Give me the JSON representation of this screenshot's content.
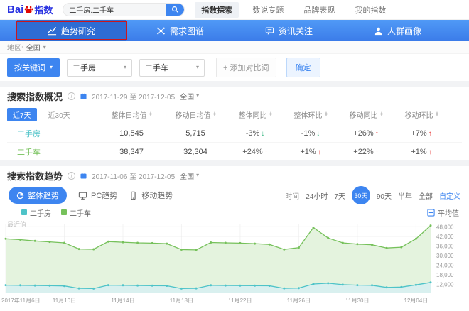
{
  "brand": {
    "text": "Bai",
    "suffix": "指数"
  },
  "header": {
    "search_value": "二手房,二手车",
    "nav": [
      {
        "label": "指数探索",
        "active": true
      },
      {
        "label": "数说专题",
        "active": false
      },
      {
        "label": "品牌表现",
        "active": false
      },
      {
        "label": "我的指数",
        "active": false
      }
    ]
  },
  "subnav": [
    {
      "label": "趋势研究",
      "icon": "trend",
      "active": true,
      "annotated": true
    },
    {
      "label": "需求图谱",
      "icon": "network",
      "active": false,
      "annotated": false
    },
    {
      "label": "资讯关注",
      "icon": "news",
      "active": false,
      "annotated": false
    },
    {
      "label": "人群画像",
      "icon": "people",
      "active": false,
      "annotated": false
    }
  ],
  "region_bar": {
    "label": "地区:",
    "value": "全国"
  },
  "keyword_bar": {
    "mode_button": "按关键词",
    "keywords": [
      "二手房",
      "二手车"
    ],
    "add_compare": "+ 添加对比词",
    "confirm": "确定"
  },
  "overview": {
    "title": "搜索指数概况",
    "date_range": "2017-11-29 至 2017-12-05",
    "region": "全国",
    "range_tabs": [
      {
        "label": "近7天",
        "active": true
      },
      {
        "label": "近30天",
        "active": false
      }
    ],
    "columns": [
      "整体日均值",
      "移动日均值",
      "整体同比",
      "整体环比",
      "移动同比",
      "移动环比"
    ],
    "rows": [
      {
        "keyword": "二手房",
        "color": "#4ec3c8",
        "values": [
          "10,545",
          "5,715"
        ],
        "changes": [
          {
            "text": "-3%",
            "dir": "down"
          },
          {
            "text": "-1%",
            "dir": "down"
          },
          {
            "text": "+26%",
            "dir": "up"
          },
          {
            "text": "+7%",
            "dir": "up"
          }
        ]
      },
      {
        "keyword": "二手车",
        "color": "#76c15b",
        "values": [
          "38,347",
          "32,304"
        ],
        "changes": [
          {
            "text": "+24%",
            "dir": "up"
          },
          {
            "text": "+1%",
            "dir": "up"
          },
          {
            "text": "+22%",
            "dir": "up"
          },
          {
            "text": "+1%",
            "dir": "up"
          }
        ]
      }
    ]
  },
  "trend": {
    "title": "搜索指数趋势",
    "date_range": "2017-11-06 至 2017-12-05",
    "region": "全国",
    "view_tabs": [
      {
        "label": "整体趋势",
        "icon": "overall",
        "active": true
      },
      {
        "label": "PC趋势",
        "icon": "pc",
        "active": false
      },
      {
        "label": "移动趋势",
        "icon": "mobile",
        "active": false
      }
    ],
    "time_label": "时间",
    "time_ranges": [
      {
        "label": "24小时",
        "active": false,
        "link": false
      },
      {
        "label": "7天",
        "active": false,
        "link": false
      },
      {
        "label": "30天",
        "active": true,
        "link": false
      },
      {
        "label": "90天",
        "active": false,
        "link": false
      },
      {
        "label": "半年",
        "active": false,
        "link": false
      },
      {
        "label": "全部",
        "active": false,
        "link": false
      },
      {
        "label": "自定义",
        "active": false,
        "link": true
      }
    ],
    "average_toggle": "平均值",
    "chart_hint": "最近值"
  },
  "chart_data": {
    "type": "line",
    "title": "搜索指数趋势",
    "x": [
      "2017-11-06",
      "2017-11-07",
      "2017-11-08",
      "2017-11-09",
      "2017-11-10",
      "2017-11-11",
      "2017-11-12",
      "2017-11-13",
      "2017-11-14",
      "2017-11-15",
      "2017-11-16",
      "2017-11-17",
      "2017-11-18",
      "2017-11-19",
      "2017-11-20",
      "2017-11-21",
      "2017-11-22",
      "2017-11-23",
      "2017-11-24",
      "2017-11-25",
      "2017-11-26",
      "2017-11-27",
      "2017-11-28",
      "2017-11-29",
      "2017-11-30",
      "2017-12-01",
      "2017-12-02",
      "2017-12-03",
      "2017-12-04",
      "2017-12-05"
    ],
    "x_tick_labels": [
      "2017年11月6日",
      "11月10日",
      "11月14日",
      "11月18日",
      "11月22日",
      "11月26日",
      "11月30日",
      "12月04日"
    ],
    "series": [
      {
        "name": "二手房",
        "color": "#4ec3c8",
        "values": [
          11600,
          11500,
          11400,
          11300,
          11100,
          9600,
          9500,
          11600,
          11500,
          11400,
          11300,
          11200,
          9500,
          9600,
          11500,
          11400,
          11350,
          11300,
          11200,
          9600,
          9800,
          12300,
          12800,
          11900,
          11600,
          11500,
          10200,
          10400,
          11800,
          13300
        ]
      },
      {
        "name": "二手车",
        "color": "#76c15b",
        "values": [
          40500,
          40000,
          39200,
          38600,
          38000,
          34200,
          34000,
          38800,
          38400,
          38000,
          37800,
          37500,
          33800,
          33600,
          38200,
          38000,
          37800,
          37500,
          37000,
          33900,
          35000,
          47500,
          41000,
          38000,
          37200,
          36800,
          34800,
          35300,
          40500,
          48800
        ]
      }
    ],
    "y_ticks": [
      48000,
      42000,
      36000,
      30000,
      24000,
      18000,
      12000
    ],
    "ylim": [
      7000,
      49500
    ],
    "xlabel": "",
    "ylabel": "",
    "grid": true,
    "legend_position": "top-left"
  }
}
